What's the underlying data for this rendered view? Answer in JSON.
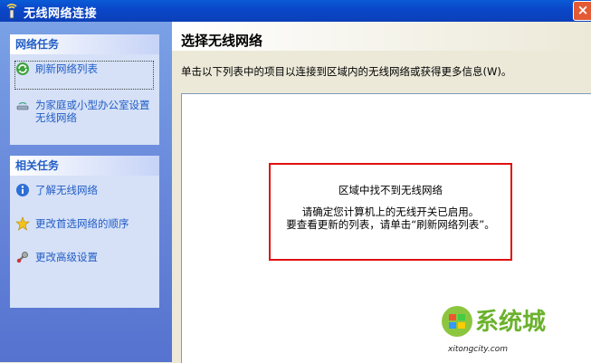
{
  "window": {
    "title": "无线网络连接",
    "close_label": "×"
  },
  "left_pane": {
    "network_tasks": {
      "header": "网络任务",
      "items": [
        {
          "label": "刷新网络列表",
          "icon": "refresh-icon"
        },
        {
          "label": "为家庭或小型办公室设置无线网络",
          "icon": "wireless-setup-icon"
        }
      ]
    },
    "related_tasks": {
      "header": "相关任务",
      "items": [
        {
          "label": "了解无线网络",
          "icon": "info-icon"
        },
        {
          "label": "更改首选网络的顺序",
          "icon": "star-icon"
        },
        {
          "label": "更改高级设置",
          "icon": "settings-icon"
        }
      ]
    }
  },
  "main": {
    "title": "选择无线网络",
    "instruction": "单击以下列表中的项目以连接到区域内的无线网络或获得更多信息(W)。",
    "message": {
      "title": "区域中找不到无线网络",
      "line1": "请确定您计算机上的无线开关已启用。",
      "line2": "要查看更新的列表，请单击“刷新网络列表”。"
    }
  },
  "watermark": {
    "brand": "系统城",
    "url": "xitongcity.com"
  },
  "colors": {
    "titlebar": "#0a47c9",
    "task_link": "#215dc6",
    "highlight_border": "#e01010",
    "brand_green": "#6bb22c"
  }
}
